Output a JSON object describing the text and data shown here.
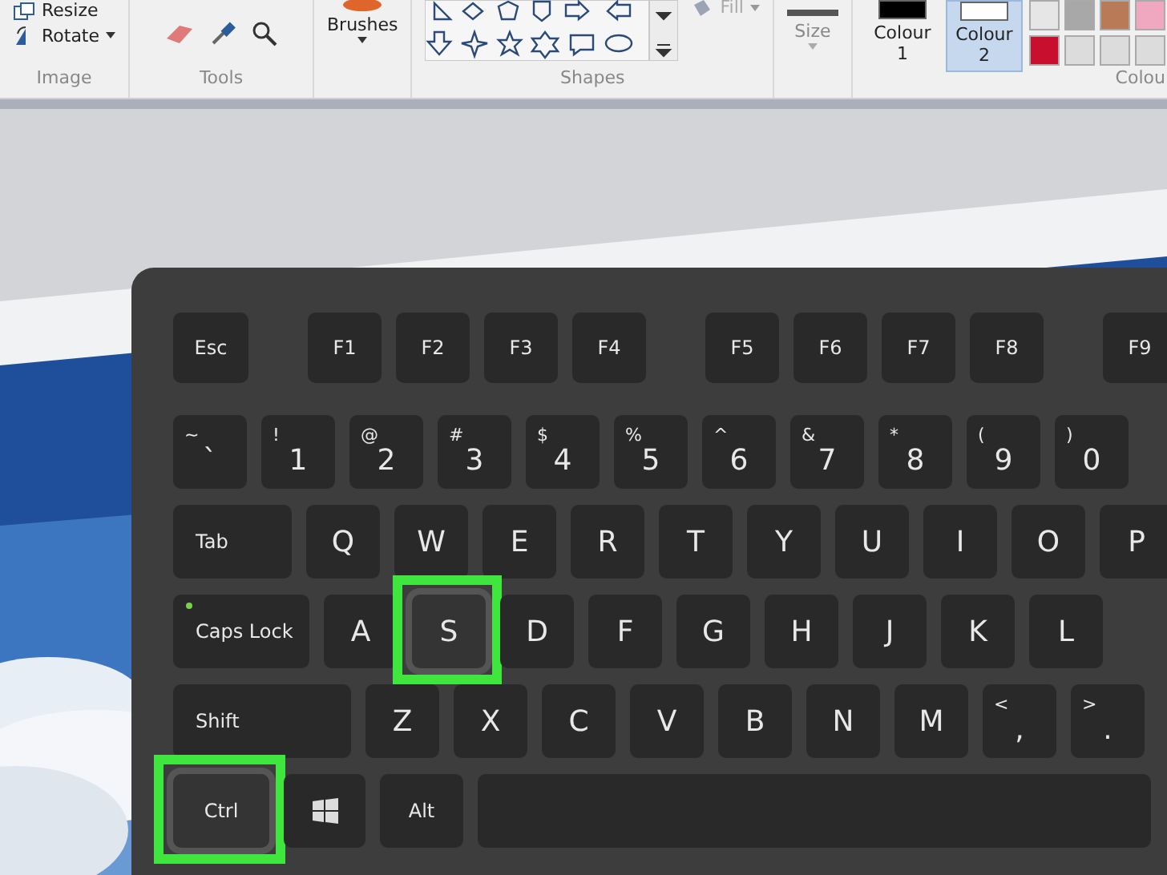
{
  "ribbon": {
    "image_group": {
      "label": "Image",
      "resize": "Resize",
      "rotate": "Rotate"
    },
    "tools_group": {
      "label": "Tools"
    },
    "brushes": {
      "label": "Brushes"
    },
    "shapes_group": {
      "label": "Shapes",
      "fill": "Fill"
    },
    "size": {
      "label": "Size"
    },
    "colours_group": {
      "label": "Colou",
      "colour_buttons": [
        {
          "label": "Colour 1",
          "selected": false,
          "color": "#000000"
        },
        {
          "label": "Colour 2",
          "selected": true,
          "color": "#ffffff"
        }
      ],
      "palette": [
        {
          "color": "#e6e6e6"
        },
        {
          "color": "#a8a8a8"
        },
        {
          "color": "#b97a57"
        },
        {
          "color": "#f0a8c0"
        },
        {
          "color": "#c8102e"
        },
        {
          "color": "#dcdcdc"
        },
        {
          "color": "#dcdcdc"
        },
        {
          "color": "#dcdcdc"
        }
      ]
    }
  },
  "keyboard": {
    "rows": [
      [
        {
          "label": "Esc",
          "kind": "esc",
          "highlighted": false
        },
        {
          "label": "F1",
          "kind": "key",
          "highlighted": false
        },
        {
          "label": "F2",
          "kind": "key",
          "highlighted": false
        },
        {
          "label": "F3",
          "kind": "key",
          "highlighted": false
        },
        {
          "label": "F4",
          "kind": "key",
          "highlighted": false
        },
        {
          "label": "F5",
          "kind": "key",
          "highlighted": false
        },
        {
          "label": "F6",
          "kind": "key",
          "highlighted": false
        },
        {
          "label": "F7",
          "kind": "key",
          "highlighted": false
        },
        {
          "label": "F8",
          "kind": "key",
          "highlighted": false
        },
        {
          "label": "F9",
          "kind": "key",
          "highlighted": false
        }
      ],
      [
        {
          "label": "`",
          "shift_label": "~",
          "kind": "key",
          "highlighted": false
        },
        {
          "label": "1",
          "shift_label": "!",
          "kind": "key",
          "highlighted": false
        },
        {
          "label": "2",
          "shift_label": "@",
          "kind": "key",
          "highlighted": false
        },
        {
          "label": "3",
          "shift_label": "#",
          "kind": "key",
          "highlighted": false
        },
        {
          "label": "4",
          "shift_label": "$",
          "kind": "key",
          "highlighted": false
        },
        {
          "label": "5",
          "shift_label": "%",
          "kind": "key",
          "highlighted": false
        },
        {
          "label": "6",
          "shift_label": "^",
          "kind": "key",
          "highlighted": false
        },
        {
          "label": "7",
          "shift_label": "&",
          "kind": "key",
          "highlighted": false
        },
        {
          "label": "8",
          "shift_label": "*",
          "kind": "key",
          "highlighted": false
        },
        {
          "label": "9",
          "shift_label": "(",
          "kind": "key",
          "highlighted": false
        },
        {
          "label": "0",
          "shift_label": ")",
          "kind": "key",
          "highlighted": false
        }
      ],
      [
        {
          "label": "Tab",
          "kind": "tab",
          "highlighted": false
        },
        {
          "label": "Q",
          "kind": "key",
          "highlighted": false
        },
        {
          "label": "W",
          "kind": "key",
          "highlighted": false
        },
        {
          "label": "E",
          "kind": "key",
          "highlighted": false
        },
        {
          "label": "R",
          "kind": "key",
          "highlighted": false
        },
        {
          "label": "T",
          "kind": "key",
          "highlighted": false
        },
        {
          "label": "Y",
          "kind": "key",
          "highlighted": false
        },
        {
          "label": "U",
          "kind": "key",
          "highlighted": false
        },
        {
          "label": "I",
          "kind": "key",
          "highlighted": false
        },
        {
          "label": "O",
          "kind": "key",
          "highlighted": false
        },
        {
          "label": "P",
          "kind": "key",
          "highlighted": false
        }
      ],
      [
        {
          "label": "Caps Lock",
          "kind": "caps",
          "highlighted": false
        },
        {
          "label": "A",
          "kind": "key",
          "highlighted": false
        },
        {
          "label": "S",
          "kind": "key",
          "highlighted": true
        },
        {
          "label": "D",
          "kind": "key",
          "highlighted": false
        },
        {
          "label": "F",
          "kind": "key",
          "highlighted": false
        },
        {
          "label": "G",
          "kind": "key",
          "highlighted": false
        },
        {
          "label": "H",
          "kind": "key",
          "highlighted": false
        },
        {
          "label": "J",
          "kind": "key",
          "highlighted": false
        },
        {
          "label": "K",
          "kind": "key",
          "highlighted": false
        },
        {
          "label": "L",
          "kind": "key",
          "highlighted": false
        }
      ],
      [
        {
          "label": "Shift",
          "kind": "shift",
          "highlighted": false
        },
        {
          "label": "Z",
          "kind": "key",
          "highlighted": false
        },
        {
          "label": "X",
          "kind": "key",
          "highlighted": false
        },
        {
          "label": "C",
          "kind": "key",
          "highlighted": false
        },
        {
          "label": "V",
          "kind": "key",
          "highlighted": false
        },
        {
          "label": "B",
          "kind": "key",
          "highlighted": false
        },
        {
          "label": "N",
          "kind": "key",
          "highlighted": false
        },
        {
          "label": "M",
          "kind": "key",
          "highlighted": false
        },
        {
          "label": ",",
          "shift_label": "<",
          "kind": "key",
          "highlighted": false
        },
        {
          "label": ".",
          "shift_label": ">",
          "kind": "key",
          "highlighted": false
        }
      ],
      [
        {
          "label": "Ctrl",
          "kind": "ctrl",
          "highlighted": true
        },
        {
          "kind": "windows",
          "highlighted": false
        },
        {
          "label": "Alt",
          "kind": "alt",
          "highlighted": false
        },
        {
          "kind": "space",
          "highlighted": false
        }
      ]
    ]
  }
}
